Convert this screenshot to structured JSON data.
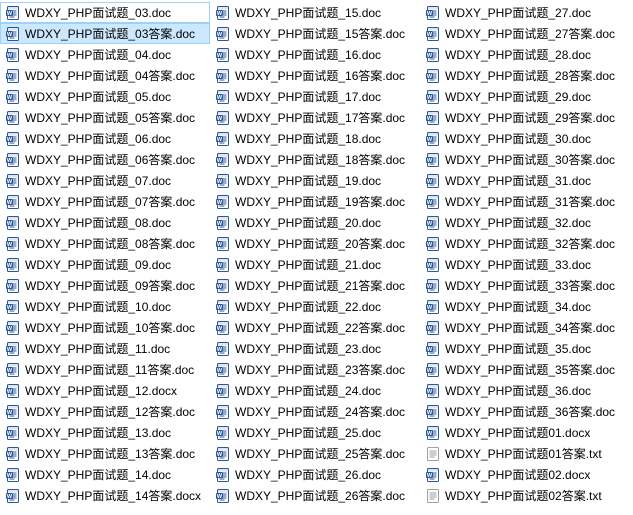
{
  "icons": {
    "doc": "word-doc-icon",
    "docx": "word-docx-icon",
    "txt": "text-file-icon"
  },
  "files": [
    {
      "name": "WDXY_PHP面试题_03.doc",
      "type": "doc",
      "state": "focused"
    },
    {
      "name": "WDXY_PHP面试题_03答案.doc",
      "type": "doc",
      "state": "selected"
    },
    {
      "name": "WDXY_PHP面试题_04.doc",
      "type": "doc"
    },
    {
      "name": "WDXY_PHP面试题_04答案.doc",
      "type": "doc"
    },
    {
      "name": "WDXY_PHP面试题_05.doc",
      "type": "doc"
    },
    {
      "name": "WDXY_PHP面试题_05答案.doc",
      "type": "doc"
    },
    {
      "name": "WDXY_PHP面试题_06.doc",
      "type": "doc"
    },
    {
      "name": "WDXY_PHP面试题_06答案.doc",
      "type": "doc"
    },
    {
      "name": "WDXY_PHP面试题_07.doc",
      "type": "doc"
    },
    {
      "name": "WDXY_PHP面试题_07答案.doc",
      "type": "doc"
    },
    {
      "name": "WDXY_PHP面试题_08.doc",
      "type": "doc"
    },
    {
      "name": "WDXY_PHP面试题_08答案.doc",
      "type": "doc"
    },
    {
      "name": "WDXY_PHP面试题_09.doc",
      "type": "doc"
    },
    {
      "name": "WDXY_PHP面试题_09答案.doc",
      "type": "doc"
    },
    {
      "name": "WDXY_PHP面试题_10.doc",
      "type": "doc"
    },
    {
      "name": "WDXY_PHP面试题_10答案.doc",
      "type": "doc"
    },
    {
      "name": "WDXY_PHP面试题_11.doc",
      "type": "doc"
    },
    {
      "name": "WDXY_PHP面试题_11答案.doc",
      "type": "doc"
    },
    {
      "name": "WDXY_PHP面试题_12.docx",
      "type": "docx"
    },
    {
      "name": "WDXY_PHP面试题_12答案.doc",
      "type": "doc"
    },
    {
      "name": "WDXY_PHP面试题_13.doc",
      "type": "doc"
    },
    {
      "name": "WDXY_PHP面试题_13答案.doc",
      "type": "doc"
    },
    {
      "name": "WDXY_PHP面试题_14.doc",
      "type": "doc"
    },
    {
      "name": "WDXY_PHP面试题_14答案.docx",
      "type": "docx"
    },
    {
      "name": "WDXY_PHP面试题_15.doc",
      "type": "doc"
    },
    {
      "name": "WDXY_PHP面试题_15答案.doc",
      "type": "doc"
    },
    {
      "name": "WDXY_PHP面试题_16.doc",
      "type": "doc"
    },
    {
      "name": "WDXY_PHP面试题_16答案.doc",
      "type": "doc"
    },
    {
      "name": "WDXY_PHP面试题_17.doc",
      "type": "doc"
    },
    {
      "name": "WDXY_PHP面试题_17答案.doc",
      "type": "doc"
    },
    {
      "name": "WDXY_PHP面试题_18.doc",
      "type": "doc"
    },
    {
      "name": "WDXY_PHP面试题_18答案.doc",
      "type": "doc"
    },
    {
      "name": "WDXY_PHP面试题_19.doc",
      "type": "doc"
    },
    {
      "name": "WDXY_PHP面试题_19答案.doc",
      "type": "doc"
    },
    {
      "name": "WDXY_PHP面试题_20.doc",
      "type": "doc"
    },
    {
      "name": "WDXY_PHP面试题_20答案.doc",
      "type": "doc"
    },
    {
      "name": "WDXY_PHP面试题_21.doc",
      "type": "doc"
    },
    {
      "name": "WDXY_PHP面试题_21答案.doc",
      "type": "doc"
    },
    {
      "name": "WDXY_PHP面试题_22.doc",
      "type": "doc"
    },
    {
      "name": "WDXY_PHP面试题_22答案.doc",
      "type": "doc"
    },
    {
      "name": "WDXY_PHP面试题_23.doc",
      "type": "doc"
    },
    {
      "name": "WDXY_PHP面试题_23答案.doc",
      "type": "doc"
    },
    {
      "name": "WDXY_PHP面试题_24.doc",
      "type": "doc"
    },
    {
      "name": "WDXY_PHP面试题_24答案.doc",
      "type": "doc"
    },
    {
      "name": "WDXY_PHP面试题_25.doc",
      "type": "doc"
    },
    {
      "name": "WDXY_PHP面试题_25答案.doc",
      "type": "doc"
    },
    {
      "name": "WDXY_PHP面试题_26.doc",
      "type": "doc"
    },
    {
      "name": "WDXY_PHP面试题_26答案.doc",
      "type": "doc"
    },
    {
      "name": "WDXY_PHP面试题_27.doc",
      "type": "doc"
    },
    {
      "name": "WDXY_PHP面试题_27答案.doc",
      "type": "doc"
    },
    {
      "name": "WDXY_PHP面试题_28.doc",
      "type": "doc"
    },
    {
      "name": "WDXY_PHP面试题_28答案.doc",
      "type": "doc"
    },
    {
      "name": "WDXY_PHP面试题_29.doc",
      "type": "doc"
    },
    {
      "name": "WDXY_PHP面试题_29答案.doc",
      "type": "doc"
    },
    {
      "name": "WDXY_PHP面试题_30.doc",
      "type": "doc"
    },
    {
      "name": "WDXY_PHP面试题_30答案.doc",
      "type": "doc"
    },
    {
      "name": "WDXY_PHP面试题_31.doc",
      "type": "doc"
    },
    {
      "name": "WDXY_PHP面试题_31答案.doc",
      "type": "doc"
    },
    {
      "name": "WDXY_PHP面试题_32.doc",
      "type": "doc"
    },
    {
      "name": "WDXY_PHP面试题_32答案.doc",
      "type": "doc"
    },
    {
      "name": "WDXY_PHP面试题_33.doc",
      "type": "doc"
    },
    {
      "name": "WDXY_PHP面试题_33答案.doc",
      "type": "doc"
    },
    {
      "name": "WDXY_PHP面试题_34.doc",
      "type": "doc"
    },
    {
      "name": "WDXY_PHP面试题_34答案.doc",
      "type": "doc"
    },
    {
      "name": "WDXY_PHP面试题_35.doc",
      "type": "doc"
    },
    {
      "name": "WDXY_PHP面试题_35答案.doc",
      "type": "doc"
    },
    {
      "name": "WDXY_PHP面试题_36.doc",
      "type": "doc"
    },
    {
      "name": "WDXY_PHP面试题_36答案.doc",
      "type": "doc"
    },
    {
      "name": "WDXY_PHP面试题01.docx",
      "type": "docx"
    },
    {
      "name": "WDXY_PHP面试题01答案.txt",
      "type": "txt"
    },
    {
      "name": "WDXY_PHP面试题02.docx",
      "type": "docx"
    },
    {
      "name": "WDXY_PHP面试题02答案.txt",
      "type": "txt"
    }
  ]
}
